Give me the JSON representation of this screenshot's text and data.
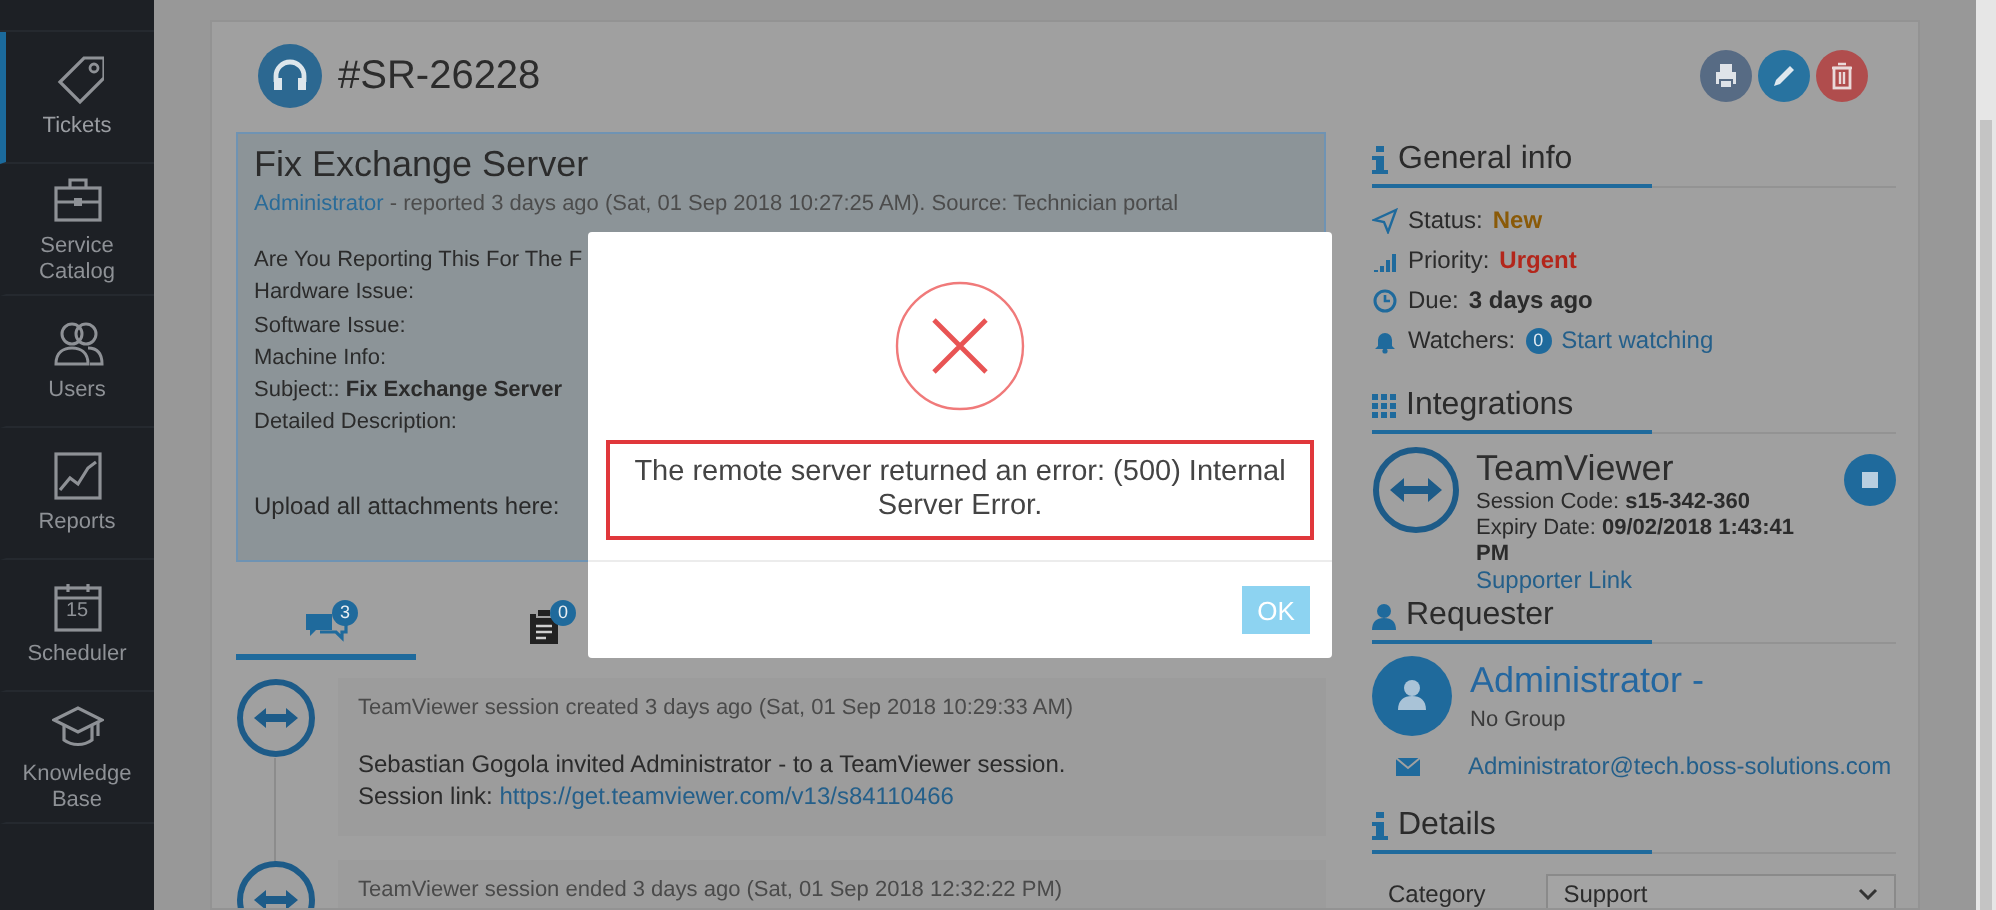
{
  "sidebar": {
    "items": [
      {
        "label": "Tickets",
        "kind": "tag",
        "selected": true
      },
      {
        "label": "Service Catalog",
        "kind": "briefcase",
        "selected": false
      },
      {
        "label": "Users",
        "kind": "users",
        "selected": false
      },
      {
        "label": "Reports",
        "kind": "chart",
        "selected": false
      },
      {
        "label": "Scheduler",
        "kind": "calendar",
        "selected": false,
        "badge": "15"
      },
      {
        "label": "Knowledge Base",
        "kind": "cap",
        "selected": false
      }
    ]
  },
  "ticket": {
    "number": "#SR-26228",
    "title": "Fix Exchange Server",
    "reporter": "Administrator",
    "meta": " - reported 3 days ago (Sat, 01 Sep 2018 10:27:25 AM). Source: Technician portal",
    "fields": [
      "Are You Reporting This For The F",
      "Hardware Issue:",
      "Software Issue:",
      "Machine Info:",
      "Subject:: **Fix Exchange Server**",
      "Detailed Description:"
    ],
    "upload": "Upload all attachments here:"
  },
  "tabs": [
    {
      "kind": "comments",
      "count": "3",
      "selected": true
    },
    {
      "kind": "tasks",
      "count": "0",
      "selected": false
    }
  ],
  "timeline": [
    {
      "header": "TeamViewer session created 3 days ago (Sat, 01 Sep 2018 10:29:33 AM)",
      "body": "Sebastian Gogola invited Administrator - to a TeamViewer session.",
      "link_label": "Session link:",
      "link": "https://get.teamviewer.com/v13/s84110466"
    },
    {
      "header": "TeamViewer session ended 3 days ago (Sat, 01 Sep 2018 12:32:22 PM)"
    }
  ],
  "general_info": {
    "title": "General info",
    "rows": [
      {
        "kind": "status",
        "label": "Status:",
        "value": "New"
      },
      {
        "kind": "priority",
        "label": "Priority:",
        "value": "Urgent"
      },
      {
        "kind": "due",
        "label": "Due:",
        "value": "3 days ago"
      },
      {
        "kind": "watchers",
        "label": "Watchers:",
        "count": "0",
        "value": "Start watching"
      }
    ]
  },
  "integrations": {
    "title": "Integrations",
    "name": "TeamViewer",
    "session_code_label": "Session Code:",
    "session_code": "s15-342-360",
    "expiry_label": "Expiry Date:",
    "expiry": "09/02/2018 1:43:41 PM",
    "link": "Supporter Link"
  },
  "requester": {
    "title": "Requester",
    "name": "Administrator -",
    "group": "No Group",
    "email": "Administrator@tech.boss-solutions.com"
  },
  "details": {
    "title": "Details",
    "fields": [
      {
        "label": "Category",
        "value": "Support"
      }
    ]
  },
  "dialog": {
    "message": "The remote server returned an error: (500) Internal Server Error.",
    "button": "OK"
  }
}
